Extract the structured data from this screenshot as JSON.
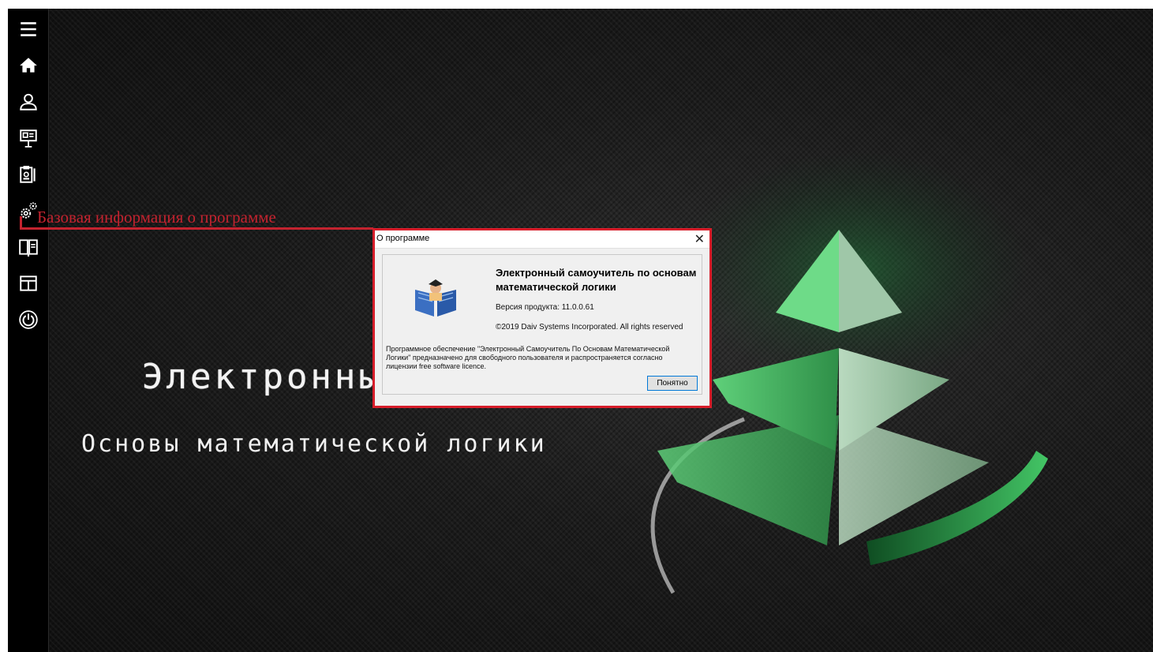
{
  "main": {
    "title": "Электронный",
    "subtitle": "Основы математической логики"
  },
  "annotation": {
    "text": "Базовая информация о программе",
    "color": "#c3232f"
  },
  "dialog": {
    "title": "О программе",
    "close_label": "✕",
    "product_name": "Электронный самоучитель по основам  математической логики",
    "version": "Версия продукта: 11.0.0.61",
    "copyright": "©2019 Daiv Systems Incorporated. All rights reserved",
    "description": "Программное обеспечение \"Электронный Самоучитель По Основам Математической Логики\" предназначено для свободного пользователя и распространяется согласно лицензии  free software licence.",
    "ok_label": "Понятно",
    "border_color": "#d71d2a"
  },
  "sidebar": {
    "items": [
      {
        "icon": "menu-icon"
      },
      {
        "icon": "home-icon"
      },
      {
        "icon": "user-icon"
      },
      {
        "icon": "presentation-icon"
      },
      {
        "icon": "clipboard-icon"
      },
      {
        "icon": "gears-icon"
      },
      {
        "icon": "book-icon"
      },
      {
        "icon": "layout-icon"
      },
      {
        "icon": "power-icon"
      }
    ]
  }
}
